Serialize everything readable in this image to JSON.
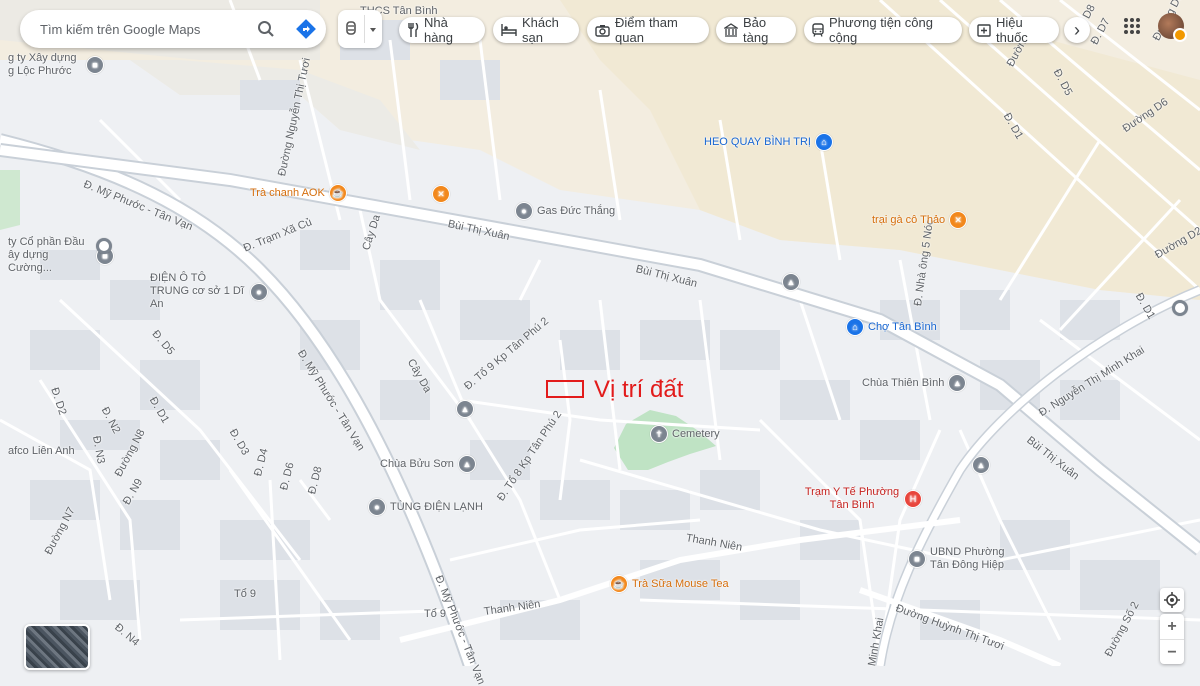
{
  "search": {
    "placeholder": "Tìm kiếm trên Google Maps"
  },
  "icons": {
    "search": "search-icon",
    "directions": "directions-icon",
    "layers": "layers-icon",
    "apps": "apps-grid-icon",
    "locate": "my-location-icon"
  },
  "chips": [
    {
      "label": "Nhà hàng",
      "icon": "restaurant-icon"
    },
    {
      "label": "Khách sạn",
      "icon": "hotel-icon"
    },
    {
      "label": "Điểm tham quan",
      "icon": "camera-icon"
    },
    {
      "label": "Bảo tàng",
      "icon": "museum-icon"
    },
    {
      "label": "Phương tiện công cộng",
      "icon": "transit-icon"
    },
    {
      "label": "Hiệu thuốc",
      "icon": "pharmacy-icon"
    }
  ],
  "controls": {
    "zoom_in": "+",
    "zoom_out": "−",
    "chips_next": "›"
  },
  "annotation": {
    "label": "Vị trí đất",
    "color": "#e21b1b"
  },
  "roads": {
    "my_phuoc_tan_van_1": "Đ. Mỹ Phước - Tân Vạn",
    "my_phuoc_tan_van_2": "Đ. Mỹ Phước - Tân Vạn",
    "my_phuoc_tan_van_3": "Đ. Mỹ Phước - Tân Vạn",
    "bui_thi_xuan_1": "Bùi Thị Xuân",
    "bui_thi_xuan_2": "Bùi Thị Xuân",
    "bui_thi_xuan_3": "Bùi Thị Xuân",
    "nguyen_thi_tuoi": "Đường Nguyễn Thị Tươi",
    "tram_xa_cu": "Đ. Trạm Xã Củ",
    "cay_da_1": "Cây Da",
    "cay_da_2": "Cây Da",
    "to9_kp_tan_phu2": "Đ. Tổ 9 Kp Tân Phú 2",
    "to8_kp_tan_phu2": "Đ. Tổ 8 Kp Tân Phú 2",
    "thanh_nien_1": "Thanh Niên",
    "thanh_nien_2": "Thanh Niên",
    "nguyen_thi_minh_khai_1": "Đ. Nguyễn Thị Minh Khai",
    "nguyen_thi_minh_khai_2": "Minh Khai",
    "huynh_thi_tuoi": "Đường Huỳnh Thị Tươi",
    "nha_ong_5_noc": "Đ. Nhà ông 5 Nóc",
    "d_d1": "Đ. D1",
    "d_d2": "Đ. D2",
    "d_d3": "Đ. D3",
    "d_d4": "Đ. D4",
    "d_d5": "Đ. D5",
    "d_d5_right": "Đ. D5",
    "d_d6": "Đ. D6",
    "d_d8": "Đ. D8",
    "d_d1_right": "Đ. D1",
    "duong_d3": "Đường D3",
    "d_d7": "Đ. D7",
    "d_d8_top": "D8",
    "duong_d6": "Đường D6",
    "duong_d9": "Đường D9",
    "duong_d2": "Đường D2",
    "d_d1_mid": "Đ. D1",
    "d_n2": "Đ. N2",
    "d_n3": "Đ. N3",
    "d_n9": "Đ. N9",
    "d_n4": "Đ. N4",
    "duong_n7": "Đường N7",
    "duong_n8": "Đường N8",
    "to9_a": "Tổ 9",
    "to9_b": "Tổ 9",
    "duong_so2": "Đường Số 2"
  },
  "pois": [
    {
      "label": "Trà chanh AOK",
      "kind": "cafe-icon",
      "color": "orange"
    },
    {
      "label": "Gas Đức Thắng",
      "kind": "store-icon",
      "color": "gray"
    },
    {
      "label": "HEO QUAY BÌNH TRỊ",
      "kind": "shop-icon",
      "color": "blue"
    },
    {
      "label": "trại gà cô Thảo",
      "kind": "restaurant-icon",
      "color": "orange"
    },
    {
      "label": "Chợ Tân Bình",
      "kind": "market-icon",
      "color": "blue"
    },
    {
      "label": "Chùa Thiên Bình",
      "kind": "temple-icon",
      "color": "gray"
    },
    {
      "label": "Cemetery",
      "kind": "cemetery-icon",
      "color": "gray"
    },
    {
      "label": "Chùa Bửu Sơn",
      "kind": "temple-icon",
      "color": "gray"
    },
    {
      "label": "TÙNG ĐIỆN LẠNH",
      "kind": "store-icon",
      "color": "gray"
    },
    {
      "label": "Trà Sữa Mouse Tea",
      "kind": "cafe-icon",
      "color": "orange"
    },
    {
      "label": "Trạm Y Tế Phường Tân Bình",
      "kind": "hospital-icon",
      "color": "red"
    },
    {
      "label": "UBND Phường Tân Đông Hiệp",
      "kind": "government-icon",
      "color": "gray"
    },
    {
      "label": "ĐIỆN Ô TÔ TRUNG cơ sở 1 Dĩ An",
      "kind": "store-icon",
      "color": "gray"
    },
    {
      "label": "THCS Tân Bình",
      "kind": "school-icon",
      "color": "gray"
    },
    {
      "label": "ty Cổ phần Đầu ây dựng Cường...",
      "kind": "business-icon",
      "color": "gray"
    },
    {
      "label": "g ty Xây dựng g Lộc Phước",
      "kind": "business-icon",
      "color": "gray"
    },
    {
      "label": "afco Liên Anh",
      "kind": "business-icon",
      "color": "gray"
    }
  ]
}
